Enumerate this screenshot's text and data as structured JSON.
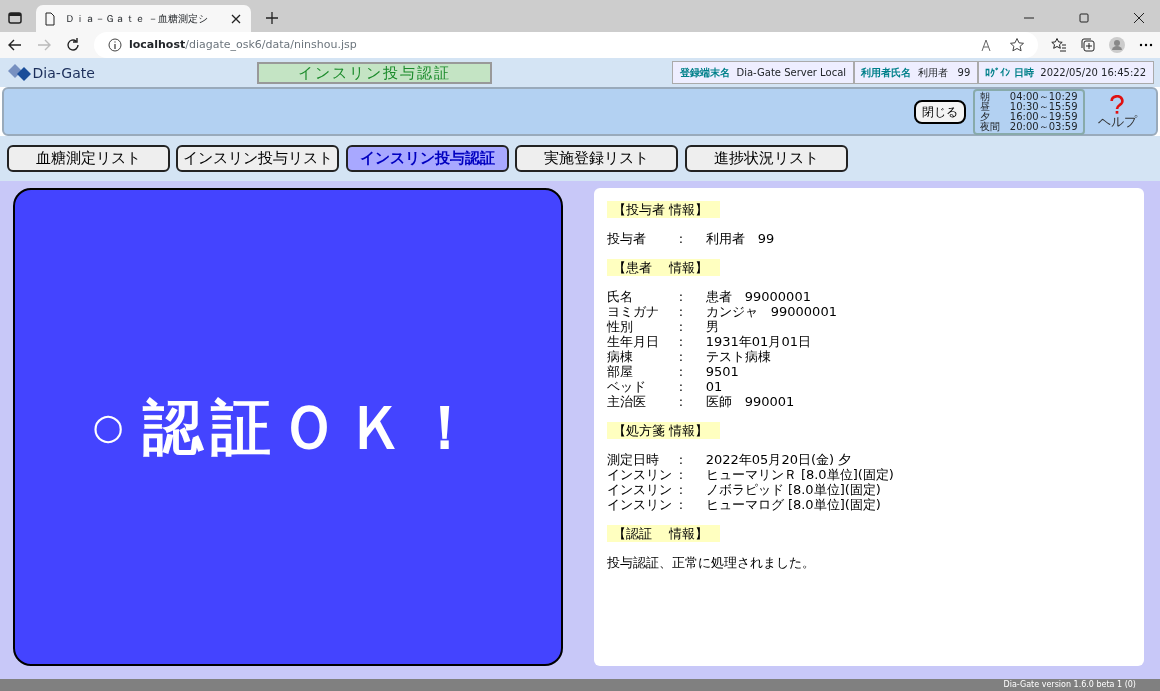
{
  "browser": {
    "tab_title": "Ｄｉａ－Ｇａｔｅ －血糖測定シ",
    "url_host": "localhost",
    "url_path": "/diagate_osk6/data/ninshou.jsp"
  },
  "header": {
    "logo_text": "Dia-Gate",
    "page_title": "インスリン投与認証",
    "info": [
      {
        "label": "登録端末名",
        "value": "Dia-Gate Server Local"
      },
      {
        "label": "利用者氏名",
        "value": "利用者　99"
      },
      {
        "label": "ﾛｸﾞｲﾝ 日時",
        "value": "2022/05/20 16:45:22"
      }
    ]
  },
  "toolbar": {
    "close_button": "閉じる",
    "schedule": [
      {
        "period": "朝",
        "range": "04:00～10:29"
      },
      {
        "period": "昼",
        "range": "10:30～15:59"
      },
      {
        "period": "夕",
        "range": "16:00～19:59"
      },
      {
        "period": "夜間",
        "range": "20:00～03:59"
      }
    ],
    "help_label": "ヘルプ"
  },
  "nav_tabs": [
    {
      "label": "血糖測定リスト",
      "selected": false
    },
    {
      "label": "インスリン投与リスト",
      "selected": false
    },
    {
      "label": "インスリン投与認証",
      "selected": true
    },
    {
      "label": "実施登録リスト",
      "selected": false
    },
    {
      "label": "進捗状況リスト",
      "selected": false
    }
  ],
  "result": {
    "mark": "○",
    "text": "認証ＯＫ！"
  },
  "sections": [
    {
      "heading": "【投与者 情報】",
      "rows": [
        {
          "label": "投与者",
          "sep": ":",
          "value": "利用者　99"
        }
      ]
    },
    {
      "heading": "【患者　 情報】",
      "rows": [
        {
          "label": "氏名",
          "sep": ":",
          "value": "患者　99000001"
        },
        {
          "label": "ヨミガナ",
          "sep": ":",
          "value": "カンジャ　99000001"
        },
        {
          "label": "性別",
          "sep": ":",
          "value": "男"
        },
        {
          "label": "生年月日",
          "sep": ":",
          "value": "1931年01月01日"
        },
        {
          "label": "病棟",
          "sep": ":",
          "value": "テスト病棟"
        },
        {
          "label": "部屋",
          "sep": ":",
          "value": "9501"
        },
        {
          "label": "ベッド",
          "sep": ":",
          "value": "01"
        },
        {
          "label": "主治医",
          "sep": ":",
          "value": "医師　990001"
        }
      ]
    },
    {
      "heading": "【処方箋 情報】",
      "rows": [
        {
          "label": "測定日時",
          "sep": ":",
          "value": "2022年05月20日(金) 夕"
        },
        {
          "label": "インスリン",
          "sep": ":",
          "value": "ヒューマリンＲ [8.0単位](固定)"
        },
        {
          "label": "インスリン",
          "sep": ":",
          "value": "ノボラピッド [8.0単位](固定)"
        },
        {
          "label": "インスリン",
          "sep": ":",
          "value": "ヒューマログ [8.0単位](固定)"
        }
      ]
    },
    {
      "heading": "【認証　 情報】",
      "message": "投与認証、正常に処理されました。"
    }
  ],
  "footer": {
    "version": "Dia-Gate version 1.6.0 beta 1 (0)"
  }
}
